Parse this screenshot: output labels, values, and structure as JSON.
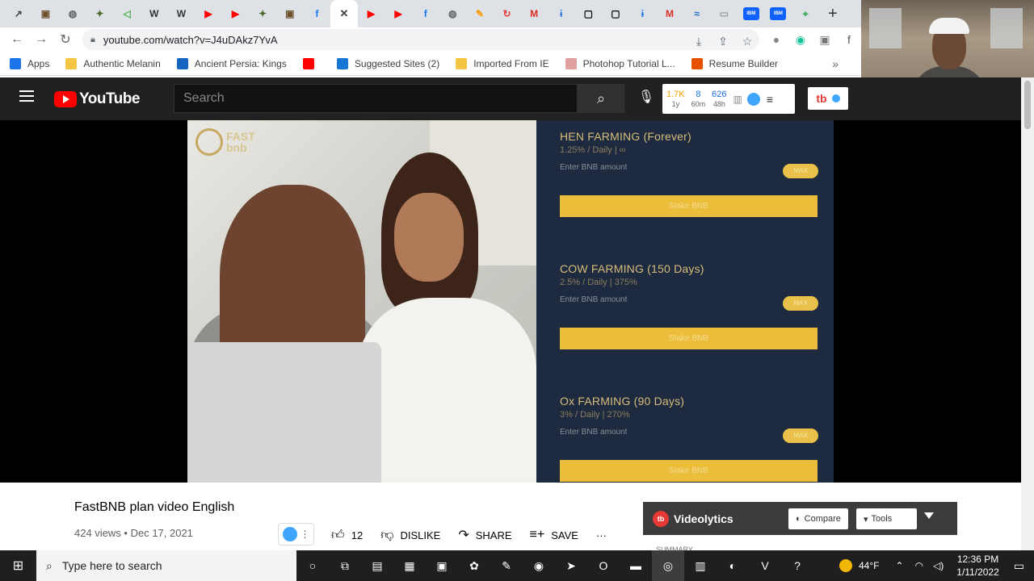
{
  "browser": {
    "tabs": [
      {
        "icon": "trend-icon",
        "color": "#3c4043",
        "glyph": "↗"
      },
      {
        "icon": "image-tab-icon",
        "color": "#6b4f2a",
        "glyph": "▣"
      },
      {
        "icon": "globe-icon",
        "color": "#5f6368",
        "glyph": "◍"
      },
      {
        "icon": "bird-icon",
        "color": "#4a6b2a",
        "glyph": "✦"
      },
      {
        "icon": "arrow-tab-icon",
        "color": "#4caf50",
        "glyph": "◁"
      },
      {
        "icon": "wikipedia-icon",
        "color": "#333333",
        "glyph": "W"
      },
      {
        "icon": "wikipedia-icon",
        "color": "#333333",
        "glyph": "W"
      },
      {
        "icon": "youtube-icon",
        "color": "#ff0000",
        "glyph": "▶"
      },
      {
        "icon": "youtube-icon",
        "color": "#ff0000",
        "glyph": "▶"
      },
      {
        "icon": "bird-icon",
        "color": "#4a6b2a",
        "glyph": "✦"
      },
      {
        "icon": "image-tab-icon",
        "color": "#6b4f2a",
        "glyph": "▣"
      },
      {
        "icon": "facebook-icon",
        "color": "#1877f2",
        "glyph": "f"
      },
      {
        "icon": "close-icon",
        "color": "#3c4043",
        "glyph": "✕",
        "active": true
      },
      {
        "icon": "youtube-icon",
        "color": "#ff0000",
        "glyph": "▶"
      },
      {
        "icon": "youtube-icon",
        "color": "#ff0000",
        "glyph": "▶"
      },
      {
        "icon": "facebook-icon",
        "color": "#1877f2",
        "glyph": "f"
      },
      {
        "icon": "globe-icon",
        "color": "#5f6368",
        "glyph": "◍"
      },
      {
        "icon": "pen-icon",
        "color": "#ff9800",
        "glyph": "✎"
      },
      {
        "icon": "refresh-tab-icon",
        "color": "#e53935",
        "glyph": "↻"
      },
      {
        "icon": "gmail-icon",
        "color": "#d93025",
        "glyph": "M"
      },
      {
        "icon": "info-tab-icon",
        "color": "#1a73e8",
        "glyph": "ɨ"
      },
      {
        "icon": "square-tab-icon",
        "color": "#000000",
        "glyph": "▢"
      },
      {
        "icon": "square-tab-icon",
        "color": "#000000",
        "glyph": "▢"
      },
      {
        "icon": "info-tab-icon",
        "color": "#1a73e8",
        "glyph": "ɨ"
      },
      {
        "icon": "gmail-icon",
        "color": "#d93025",
        "glyph": "M"
      },
      {
        "icon": "wave-tab-icon",
        "color": "#1565c0",
        "glyph": "≈"
      },
      {
        "icon": "doc-tab-icon",
        "color": "#9e9e9e",
        "glyph": "▭"
      },
      {
        "icon": "ibm-icon",
        "color": "#0f62fe",
        "glyph": "IBM"
      },
      {
        "icon": "ibm-icon",
        "color": "#0f62fe",
        "glyph": "IBM"
      },
      {
        "icon": "maps-icon",
        "color": "#34a853",
        "glyph": "⌖"
      }
    ],
    "new_tab": "+",
    "url": "youtube.com/watch?v=J4uDAkz7YvA",
    "bookmarks": [
      {
        "label": "Apps",
        "icon": "apps-icon",
        "color": "#1a73e8"
      },
      {
        "label": "Authentic Melanin",
        "icon": "folder-icon",
        "color": "#f4c542"
      },
      {
        "label": "Ancient Persia: Kings",
        "icon": "bookmark-icon",
        "color": "#1565c0"
      },
      {
        "label": "",
        "icon": "youtube-icon",
        "color": "#ff0000"
      },
      {
        "label": "Suggested Sites (2)",
        "icon": "bing-icon",
        "color": "#1976d2"
      },
      {
        "label": "Imported From IE",
        "icon": "folder-icon",
        "color": "#f4c542"
      },
      {
        "label": "Photohop Tutorial L...",
        "icon": "dash-icon",
        "color": "#e0a0a0"
      },
      {
        "label": "Resume Builder",
        "icon": "dots-icon",
        "color": "#e65100"
      }
    ],
    "bookmarks_more": "»"
  },
  "youtube": {
    "logo_text": "YouTube",
    "search_placeholder": "Search",
    "stats": [
      {
        "value": "1.7K",
        "label": "1y",
        "color": "#f4a300"
      },
      {
        "value": "8",
        "label": "60m",
        "color": "#1a73e8"
      },
      {
        "value": "626",
        "label": "48h",
        "color": "#1a73e8"
      }
    ],
    "tb_logo": "tb"
  },
  "video": {
    "overlay_logo_line1": "FAST",
    "overlay_logo_line2": "bnb",
    "farms": [
      {
        "title": "HEN FARMING (Forever)",
        "rate": "1.25% / Daily | ∞",
        "enter": "Enter BNB amount",
        "pill": "MAX",
        "stake": "Stake BNB"
      },
      {
        "title": "COW FARMING (150 Days)",
        "rate": "2.5% / Daily | 375%",
        "enter": "Enter BNB amount",
        "pill": "MAX",
        "stake": "Stake BNB"
      },
      {
        "title": "Ox FARMING (90 Days)",
        "rate": "3% / Daily | 270%",
        "enter": "Enter BNB amount",
        "pill": "MAX",
        "stake": "Stake BNB"
      }
    ]
  },
  "info": {
    "title": "FastBNB plan video English",
    "meta": "424 views • Dec 17, 2021",
    "like_count": "12",
    "dislike": "DISLIKE",
    "share": "SHARE",
    "save": "SAVE",
    "more": "···",
    "videolytics": {
      "logo": "tb",
      "title": "Videolytics",
      "compare": "Compare",
      "tools": "Tools"
    },
    "summary": "SUMMARY"
  },
  "taskbar": {
    "search_placeholder": "Type here to search",
    "weather": "44°F",
    "time": "12:36 PM",
    "date": "1/11/2022",
    "apps": [
      {
        "icon": "cortana-icon",
        "glyph": "○"
      },
      {
        "icon": "task-view-icon",
        "glyph": "⧉"
      },
      {
        "icon": "notepad-icon",
        "glyph": "▤"
      },
      {
        "icon": "calculator-icon",
        "glyph": "▦"
      },
      {
        "icon": "network-app-icon",
        "glyph": "▣"
      },
      {
        "icon": "paint-icon",
        "glyph": "✿"
      },
      {
        "icon": "pen-app-icon",
        "glyph": "✎"
      },
      {
        "icon": "zoom-icon",
        "glyph": "◉"
      },
      {
        "icon": "telegram-icon",
        "glyph": "➤"
      },
      {
        "icon": "opera-icon",
        "glyph": "O"
      },
      {
        "icon": "file-explorer-icon",
        "glyph": "▬"
      },
      {
        "icon": "chrome-icon",
        "glyph": "◎"
      },
      {
        "icon": "office-icon",
        "glyph": "▥"
      },
      {
        "icon": "edge-icon",
        "glyph": "◐"
      },
      {
        "icon": "vivaldi-icon",
        "glyph": "V"
      },
      {
        "icon": "help-icon",
        "glyph": "?"
      }
    ]
  },
  "colors": {
    "yt_red": "#ff0000",
    "gold": "#ebbd3b",
    "navy": "#1e2a3f"
  }
}
